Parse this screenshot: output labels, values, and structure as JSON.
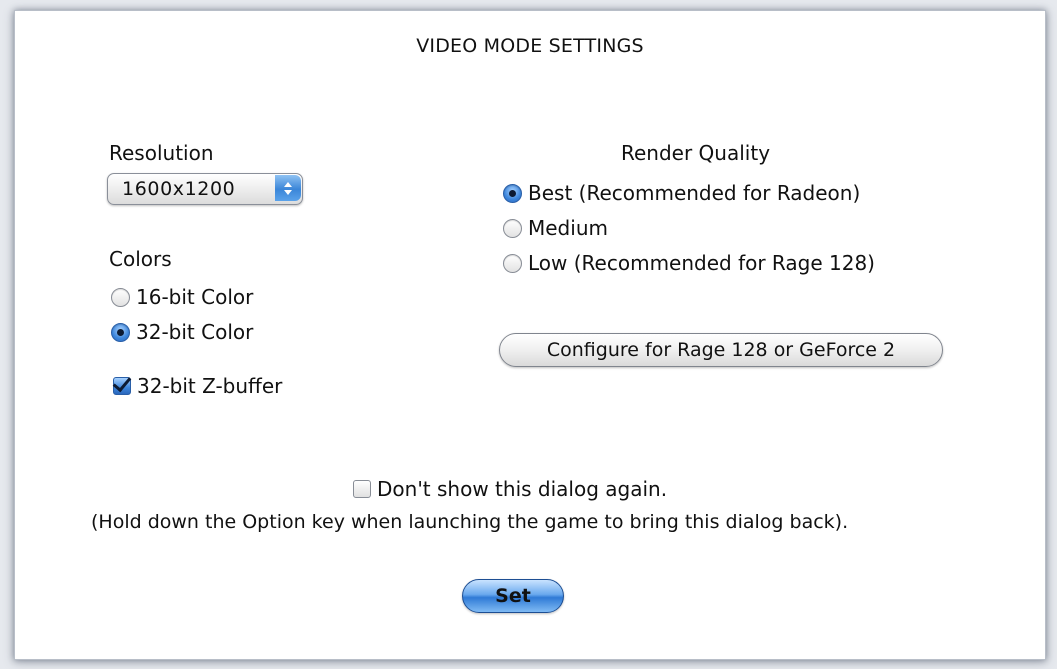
{
  "dialog": {
    "title": "VIDEO MODE SETTINGS",
    "resolution": {
      "label": "Resolution",
      "selected": "1600x1200"
    },
    "colors": {
      "label": "Colors",
      "options": [
        {
          "label": "16-bit Color",
          "selected": false
        },
        {
          "label": "32-bit Color",
          "selected": true
        }
      ],
      "zbuffer": {
        "label": "32-bit Z-buffer",
        "checked": true
      }
    },
    "render_quality": {
      "label": "Render Quality",
      "options": [
        {
          "label": "Best (Recommended for Radeon)",
          "selected": true
        },
        {
          "label": "Medium",
          "selected": false
        },
        {
          "label": "Low (Recommended for Rage 128)",
          "selected": false
        }
      ],
      "configure_button": "Configure for Rage 128 or GeForce 2"
    },
    "dont_show": {
      "label": "Don't show this dialog again.",
      "checked": false
    },
    "note": "(Hold down the Option key when launching the game to bring this dialog back).",
    "set_button": "Set"
  },
  "colors_theme": {
    "accent": "#3b86d8",
    "background": "#ffffff"
  }
}
